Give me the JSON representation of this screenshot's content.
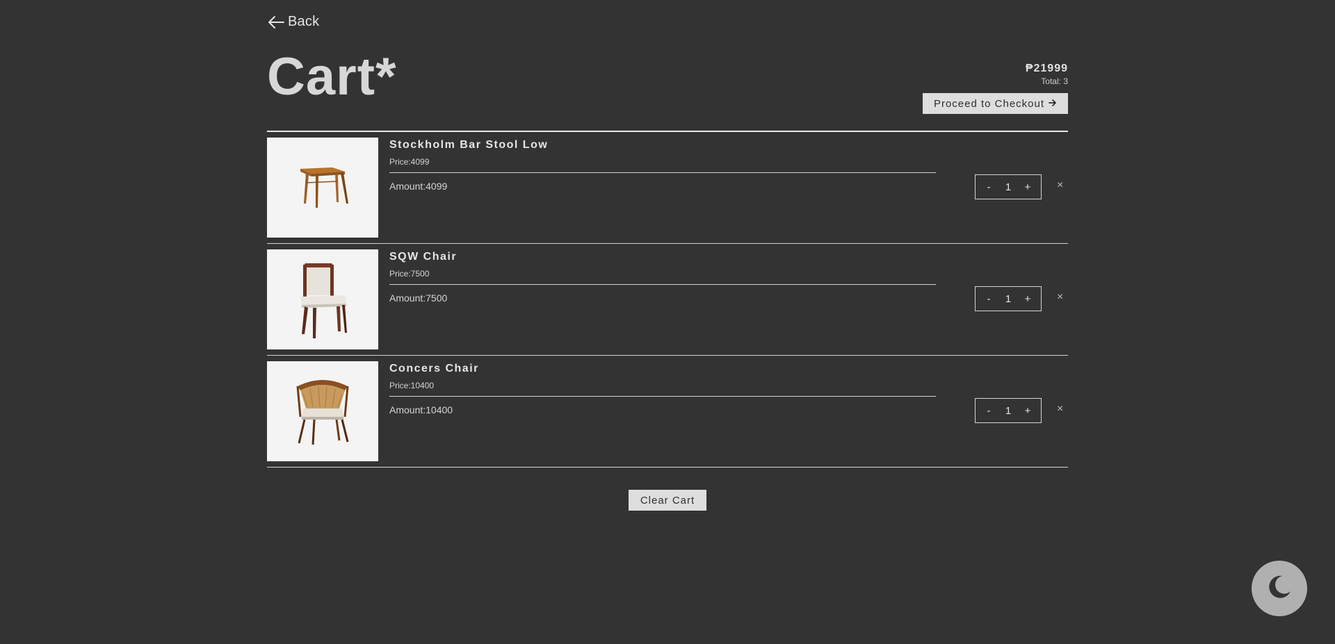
{
  "nav": {
    "back_label": "Back"
  },
  "header": {
    "title": "Cart*"
  },
  "summary": {
    "total_price": "₱21999",
    "total_count": "Total: 3",
    "checkout_label": "Proceed to Checkout"
  },
  "items": [
    {
      "name": "Stockholm Bar Stool Low",
      "price": "Price:4099",
      "amount": "Amount:4099",
      "quantity": "1",
      "decrement": "-",
      "increment": "+",
      "remove": "×",
      "image": "bar-stool-image"
    },
    {
      "name": "SQW Chair",
      "price": "Price:7500",
      "amount": "Amount:7500",
      "quantity": "1",
      "decrement": "-",
      "increment": "+",
      "remove": "×",
      "image": "upholstered-chair-image"
    },
    {
      "name": "Concers Chair",
      "price": "Price:10400",
      "amount": "Amount:10400",
      "quantity": "1",
      "decrement": "-",
      "increment": "+",
      "remove": "×",
      "image": "cane-armchair-image"
    }
  ],
  "actions": {
    "clear_label": "Clear Cart"
  },
  "theme": {
    "toggle_icon": "moon-icon"
  },
  "colors": {
    "background": "#333333",
    "text": "#e6e6e6",
    "button_bg": "#dedede",
    "image_bg": "#f4f4f4",
    "toggle_bg": "#b0b0b0"
  }
}
